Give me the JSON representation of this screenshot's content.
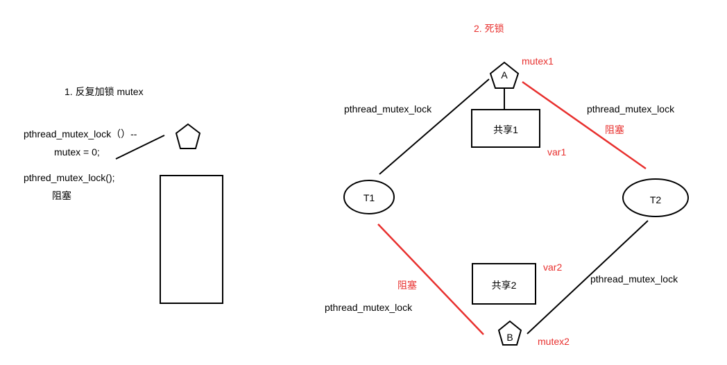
{
  "left": {
    "title": "1. 反复加锁 mutex",
    "call1": "pthread_mutex_lock（）--",
    "assign": "mutex = 0;",
    "call2": "pthred_mutex_lock();",
    "blocked": "阻塞"
  },
  "right": {
    "title": "2. 死锁",
    "mutex1": "mutex1",
    "mutex2": "mutex2",
    "node_a": "A",
    "node_b": "B",
    "thread1": "T1",
    "thread2": "T2",
    "shared1": "共享1",
    "shared2": "共享2",
    "var1": "var1",
    "var2": "var2",
    "lock_t1_a": "pthread_mutex_lock",
    "lock_t2_a": "pthread_mutex_lock",
    "lock_t1_b": "pthread_mutex_lock",
    "lock_t2_b": "pthread_mutex_lock",
    "blocked_t2_a": "阻塞",
    "blocked_t1_b": "阻塞"
  },
  "colors": {
    "red": "#e8302e",
    "black": "#000000"
  }
}
